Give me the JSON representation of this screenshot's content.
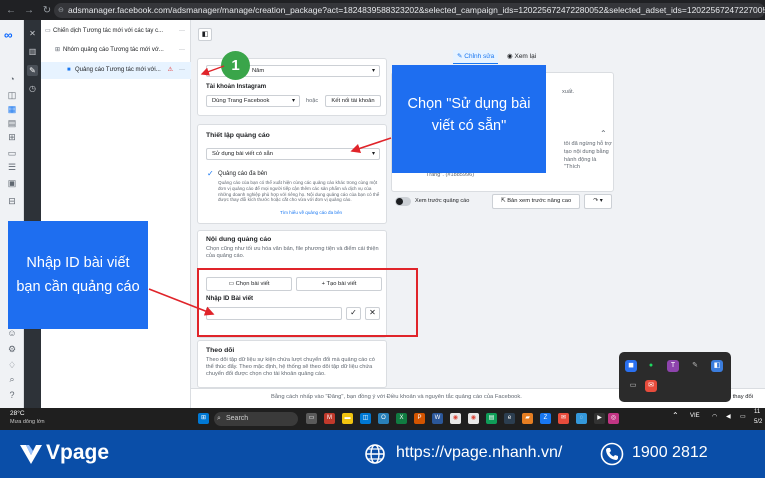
{
  "browser": {
    "url": "adsmanager.facebook.com/adsmanager/manage/creation_package?act=1824839588323202&selected_campaign_ids=120225672472280052&selected_adset_ids=120225672472270052&sele..."
  },
  "tree": {
    "items": [
      {
        "label": "Chiến dịch Tương tác mới với các tay c..."
      },
      {
        "label": "Nhóm quảng cáo Tương tác mới vớ..."
      },
      {
        "label": "Quảng cáo Tương tác mới với..."
      }
    ]
  },
  "tabs": {
    "edit": "Chỉnh sửa",
    "view": "Xem lại"
  },
  "identity": {
    "page_name_partial": "Năm",
    "instagram_label": "Tài khoản Instagram",
    "instagram_select": "Dùng Trang Facebook",
    "or_text": "hoặc",
    "connect_button": "Kết nối tài khoản"
  },
  "ad_setup": {
    "title": "Thiết lập quảng cáo",
    "select_value": "Sử dụng bài viết có sẵn",
    "multi_adv_title": "Quảng cáo đa bên",
    "multi_adv_desc": "Quảng cáo của bạn có thể xuất hiện cùng các quảng cáo khác trong cùng một đơn vị quảng cáo để mọi người tiếp cận thêm các sản phẩm và dịch vụ của những doanh nghiệp phù hợp với riêng họ. Nội dung quảng cáo của bạn có thể được thay đổi kích thước hoặc cắt cho vừa với đơn vị quảng cáo.",
    "multi_adv_link": "Tìm hiểu về quảng cáo đa bên"
  },
  "creative": {
    "title": "Nội dung quảng cáo",
    "desc": "Chọn cũng như tối ưu hóa văn bản, file phương tiện và điểm cái thiện của quảng cáo.",
    "choose_post": "Chọn bài viết",
    "create_post": "+ Tạo bài viết",
    "post_id_label": "Nhập ID Bài viết"
  },
  "tracking": {
    "title": "Theo dõi",
    "desc": "Theo dõi tập dữ liệu sự kiện chứa lượt chuyển đổi mà quảng cáo có thể thúc đẩy. Theo mặc định, hệ thống sẽ theo dõi tập dữ liệu chứa chuyển đổi được chọn cho tài khoản quảng cáo."
  },
  "preview": {
    "snippet_1": "xuất.",
    "snippet_2": "tôi đã ngừng hỗ trợ",
    "snippet_3": "tạo nội dung bằng",
    "snippet_4": "hành động là \"Thích",
    "snippet_5": "Trang\". (#1885996)",
    "toggle_label": "Xem trước quảng cáo",
    "advanced_btn": "Bản xem trước nâng cao"
  },
  "callouts": {
    "step_number": "1",
    "right": "Chọn \"Sử dụng bài viết có sẵn\"",
    "left": "Nhập ID bài viết bạn cần quảng cáo"
  },
  "footer": {
    "terms": "Bằng cách nhấp vào \"Đăng\", bạn đồng ý với Điều khoản và nguyên tắc quảng cáo của Facebook.",
    "saved": "Đã lưu mọi thay đổi"
  },
  "taskbar": {
    "temp": "28°C",
    "weather": "Mưa dông lớn",
    "search": "Search",
    "lang": "VIE",
    "time": "11",
    "date": "5/2"
  },
  "brand": {
    "name": "Vpage",
    "website": "https://vpage.nhanh.vn/",
    "phone": "1900 2812",
    "color": "#0a4ea8"
  },
  "colors": {
    "accent": "#1877f2",
    "callout": "#1e6ef0",
    "highlight": "#e0242a",
    "step": "#3aa54a"
  }
}
